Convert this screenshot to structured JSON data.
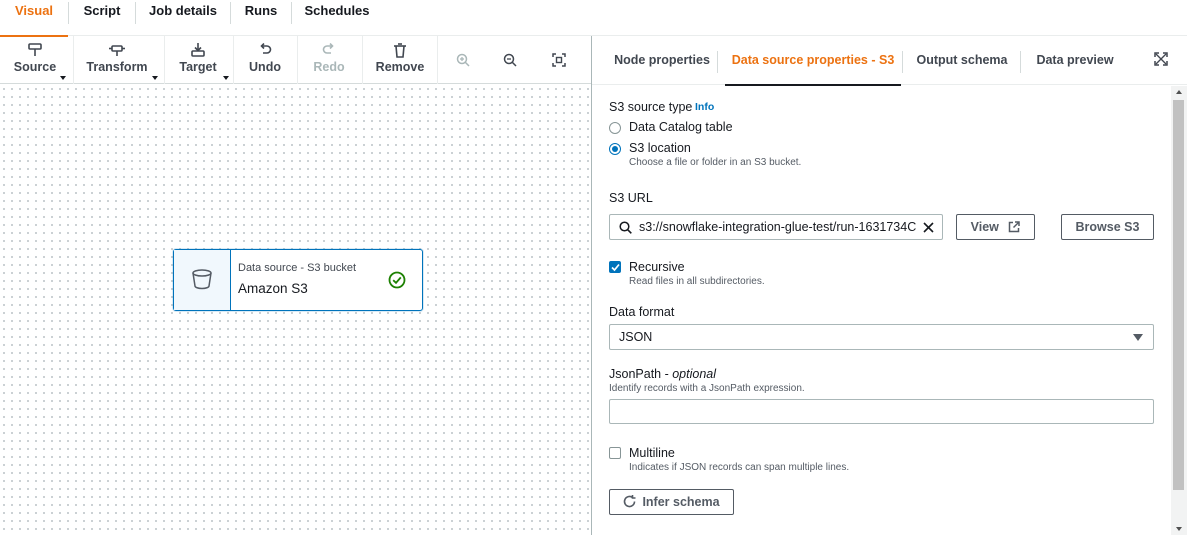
{
  "top_tabs": [
    {
      "label": "Visual",
      "active": true
    },
    {
      "label": "Script",
      "active": false
    },
    {
      "label": "Job details",
      "active": false
    },
    {
      "label": "Runs",
      "active": false
    },
    {
      "label": "Schedules",
      "active": false
    }
  ],
  "toolbar": {
    "source": "Source",
    "transform": "Transform",
    "target": "Target",
    "undo": "Undo",
    "redo": "Redo",
    "remove": "Remove"
  },
  "node": {
    "subtitle": "Data source - S3 bucket",
    "title": "Amazon S3",
    "status": "success"
  },
  "panel_tabs": [
    {
      "label": "Node properties",
      "active": false
    },
    {
      "label": "Data source properties - S3",
      "active": true
    },
    {
      "label": "Output schema",
      "active": false
    },
    {
      "label": "Data preview",
      "active": false
    }
  ],
  "form": {
    "source_type_label": "S3 source type",
    "info_link": "Info",
    "option_catalog": "Data Catalog table",
    "option_s3": "S3 location",
    "option_s3_desc": "Choose a file or folder in an S3 bucket.",
    "selected_source_type": "S3 location",
    "s3_url_label": "S3 URL",
    "s3_url_value": "s3://snowflake-integration-glue-test/run-1631734C",
    "view_button": "View",
    "browse_button": "Browse S3",
    "recursive_label": "Recursive",
    "recursive_desc": "Read files in all subdirectories.",
    "recursive_checked": true,
    "data_format_label": "Data format",
    "data_format_value": "JSON",
    "jsonpath_label": "JsonPath - ",
    "jsonpath_optional": "optional",
    "jsonpath_desc": "Identify records with a JsonPath expression.",
    "jsonpath_value": "",
    "multiline_label": "Multiline",
    "multiline_desc": "Indicates if JSON records can span multiple lines.",
    "multiline_checked": false,
    "infer_button": "Infer schema"
  },
  "colors": {
    "accent": "#ec7211",
    "link": "#0073bb",
    "success": "#1d8102"
  }
}
